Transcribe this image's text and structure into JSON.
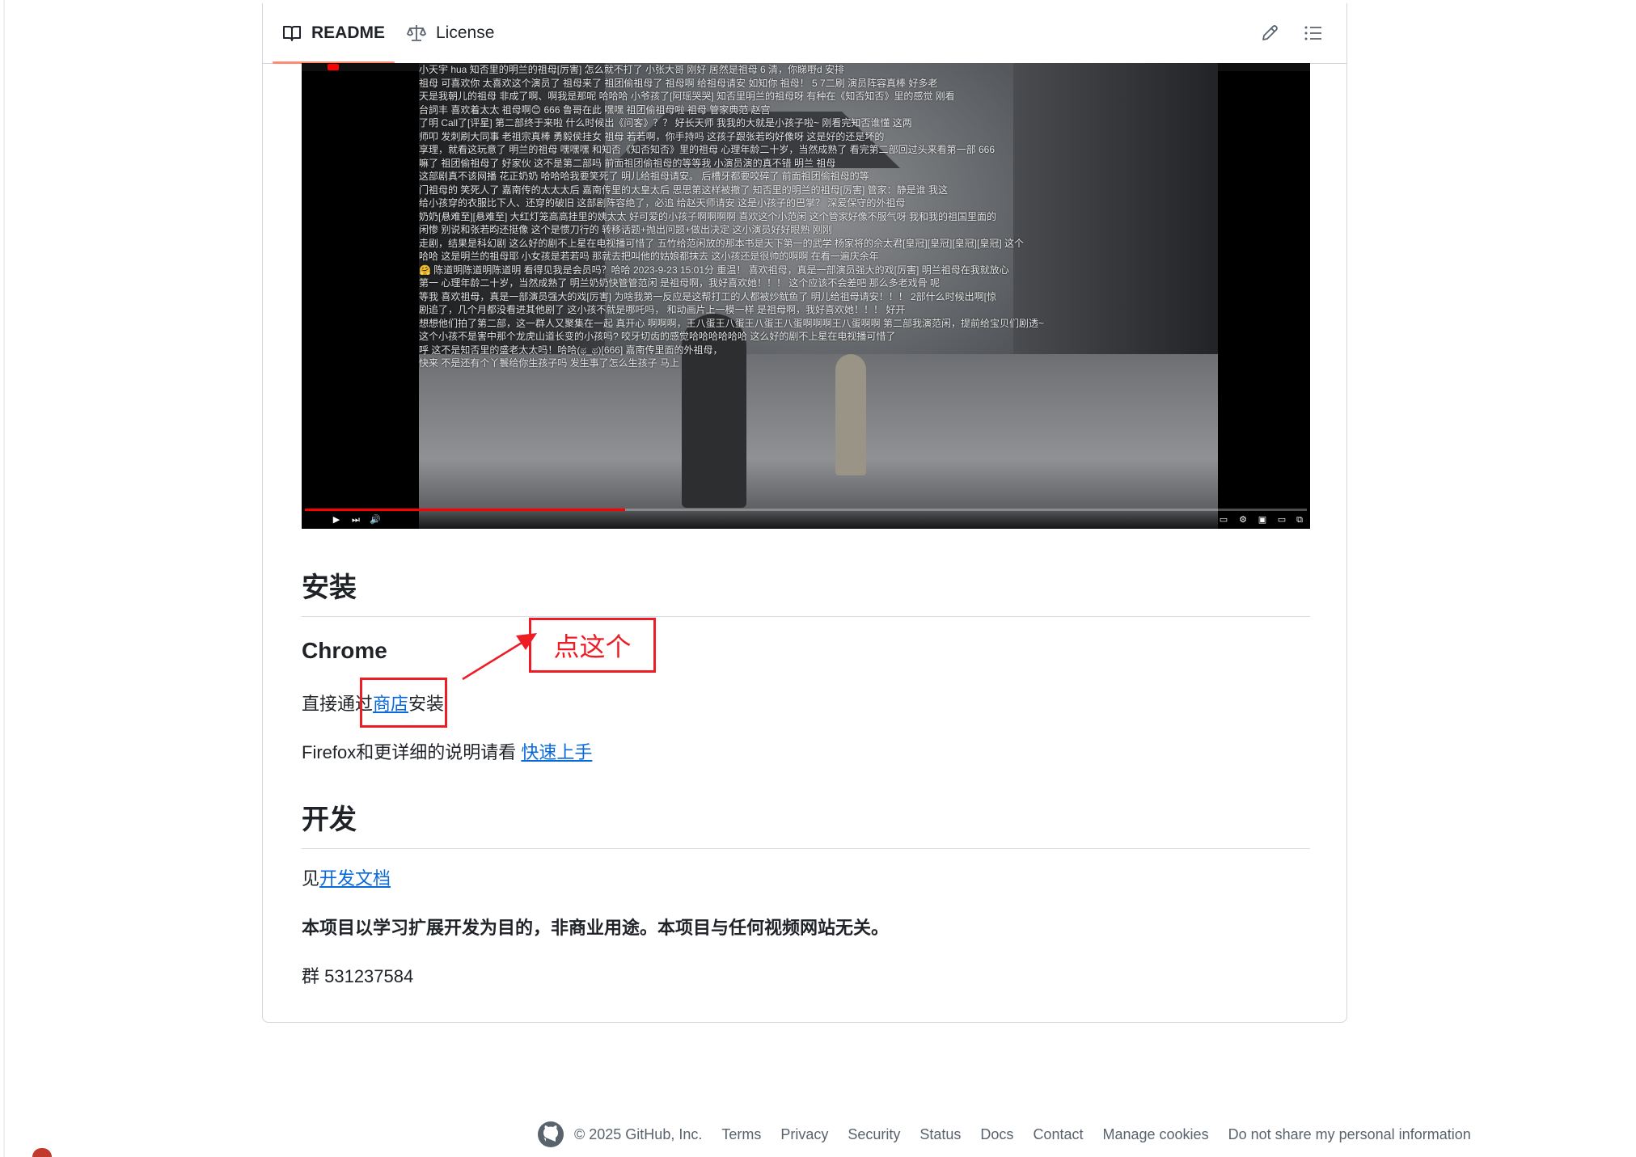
{
  "tabs": {
    "readme": "README",
    "license": "License"
  },
  "video": {
    "danmaku": [
      "小天宇        hua          知否里的明兰的祖母[厉害]      怎么就不打了  小张大哥      刚好        居然是祖母     6          清，你睇嘢d  安排",
      "祖母    可喜欢你     太喜欢这个演员了          祖母来了  祖团偷祖母了   祖母啊    给祖母请安    如知你     祖母！    5 7二刷   演员阵容真棒 好多老",
      "天是我朝儿的祖母    非成了啊、啊我是那呢         哈哈哈         小爷孩了[阿瑶哭哭]    知否里明兰的祖母呀     有种在《知否知否》里的感觉  刚看",
      "台詞丰  喜欢着太太                          祖母啊😊    666         鲁哥在此    嘿嘿      祖团偷祖母啦   祖母     管家典范              赵宫",
      "了明 Call了[评星]   第二部终于来啦   什么时候出《问客》？？     好长天师          我我的大就是小孩子啦~   刚看完知否谁懂          这两",
      "师叩    发刺刷大同事  老祖宗真棒    勇毅侯挂女     祖母            若若啊，你手持吗     这孩子跟张若昀好像呀     这是好的还是坏的",
      "享理，就看这玩意了         明兰的祖母    嘿嘿嘿      和知否《知否知否》里的祖母      心理年龄二十岁，当然成熟了 看完第二部回过头来看第一部  666",
      "嘛了      祖团偷祖母了     好家伙     这不是第二部吗     前面祖团偷祖母的等等我      小演员演的真不错    明兰          祖母",
      "这部剧真不该网播        花正奶奶     哈哈哈我要笑死了     明儿给祖母请安。           后槽牙都要咬碎了     前面祖团偷祖母的等",
      "门祖母的        笑死人了     嘉南传的太太太后     嘉南传里的太皇太后    思思第这样被撤了    知否里的明兰的祖母[厉害]  管家：静是谁 我这",
      "给小孩穿的衣服比下人、还穿的破旧      这部剧阵容绝了，必追         给赵天师请安    这是小孩子的巴掌？    深爱保守的外祖母",
      "奶奶[悬难至][悬难至]     大红灯笼高高挂里的姨太太   好可爱的小孩子啊啊啊啊     喜欢这个小范闲    这个管家好像不服气呀    我和我的祖国里面的",
      "闲惨     别说和张若昀还挺像       这个是惯刀行的    转移话题+抛出问题+做出决定    这小演员好好眼熟                  刚刚",
      "走剧，结果是科幻剧       这么好的剧不上星在电视播可惜了    五竹给范闲放的那本书是天下第一的武学   杨家将的佘太君[皇冠][皇冠][皇冠][皇冠]   这个",
      "哈哈      这是明兰的祖母耶        小女孩是若若吗     那就去把叫他的姑娘都抹去   这小孩还是很帅的啊啊       在看一遍庆余年",
      "🤗      陈道明陈道明陈道明    看得见我是会员吗？哈哈   2023-9-23 15:01分 重温！   喜欢祖母，真是一部演员强大的戏[厉害]     明兰祖母在我就放心",
      "第一 心理年龄二十岁，当然成熟了     明兰奶奶快管管范闲          是祖母啊，我好喜欢她！！！         这个应该不会差吧 那么多老戏骨 呢",
      "等我       喜欢祖母，真是一部演员强大的戏[厉害]     为啥我第一反应是这帮打工的人都被炒鱿鱼了    明儿给祖母请安！！！     2部什么时候出啊[惊",
      "剧追了，几个月都没看进其他剧了      这小孩不就是哪吒吗，    和动画片上一模一样     是祖母啊，我好喜欢她！！！                 好开",
      "想想他们拍了第二部，这一群人又聚集在一起 真开心    啊啊啊，王八蛋王八蛋王八蛋王八蛋啊啊啊王八蛋啊啊     第二部我演范闲，提前给宝贝们剧透~",
      "这个小孩不是害中那个龙虎山道长变的小孩吗?                  咬牙切齿的感觉哈哈哈哈哈哈        这么好的剧不上星在电视播可惜了",
      "呼                    这不是知否里的盛老太太吗！哈哈(ಥ_ಥ)[666]              嘉南传里面的外祖母，",
      "快来                         不是还有个丫鬟给你生孩子吗 发生事了怎么生孩子                                             马上"
    ]
  },
  "content": {
    "install_heading": "安装",
    "chrome_heading": "Chrome",
    "chrome_text_before": "直接通过",
    "chrome_link": "商店",
    "chrome_text_after": "安装",
    "firefox_text": "Firefox和更详细的说明请看 ",
    "firefox_link": "快速上手",
    "dev_heading": "开发",
    "dev_text_before": "见",
    "dev_link": "开发文档",
    "disclaimer": "本项目以学习扩展开发为目的，非商业用途。本项目与任何视频网站无关。",
    "group_text": "群 531237584"
  },
  "annotation": {
    "label": "点这个",
    "color": "#ee1c25"
  },
  "footer": {
    "copyright": "© 2025 GitHub, Inc.",
    "links": [
      "Terms",
      "Privacy",
      "Security",
      "Status",
      "Docs",
      "Contact",
      "Manage cookies",
      "Do not share my personal information"
    ]
  },
  "colors": {
    "link": "#0969da",
    "tab_underline": "#fd8c73",
    "border": "#d0d7de"
  }
}
